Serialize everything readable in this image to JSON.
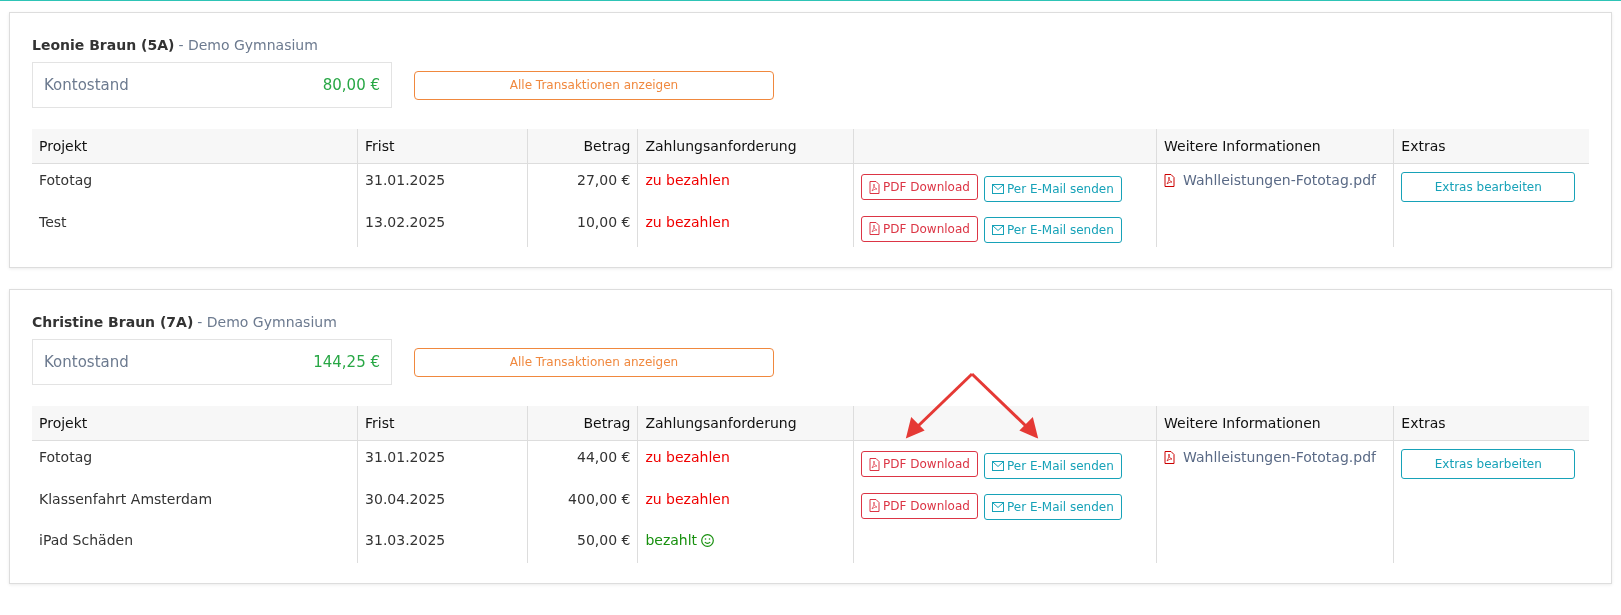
{
  "students": [
    {
      "name": "Leonie Braun (5A)",
      "school": "- Demo Gymnasium",
      "balance_label": "Kontostand",
      "balance": "80,00 €",
      "transactions_button": "Alle Transaktionen anzeigen",
      "arrow_annotation": false,
      "columns": [
        "Projekt",
        "Frist",
        "Betrag",
        "Zahlungsanforderung",
        "Weitere Informationen",
        "Extras"
      ],
      "attachment": "Wahlleistungen-Fototag.pdf",
      "extras_button": "Extras bearbeiten",
      "rows": [
        {
          "project": "Fototag",
          "due": "31.01.2025",
          "amount": "27,00 €",
          "status": "zu bezahlen",
          "kind": "unpaid",
          "buttons": [
            {
              "kind": "pdf",
              "label": "PDF Download"
            },
            {
              "kind": "email",
              "label": "Per E-Mail senden"
            }
          ]
        },
        {
          "project": "Test",
          "due": "13.02.2025",
          "amount": "10,00 €",
          "status": "zu bezahlen",
          "kind": "unpaid",
          "buttons": [
            {
              "kind": "pdf",
              "label": "PDF Download"
            },
            {
              "kind": "email",
              "label": "Per E-Mail senden"
            }
          ]
        }
      ]
    },
    {
      "name": "Christine Braun (7A)",
      "school": "- Demo Gymnasium",
      "balance_label": "Kontostand",
      "balance": "144,25 €",
      "transactions_button": "Alle Transaktionen anzeigen",
      "arrow_annotation": true,
      "columns": [
        "Projekt",
        "Frist",
        "Betrag",
        "Zahlungsanforderung",
        "Weitere Informationen",
        "Extras"
      ],
      "attachment": "Wahlleistungen-Fototag.pdf",
      "extras_button": "Extras bearbeiten",
      "rows": [
        {
          "project": "Fototag",
          "due": "31.01.2025",
          "amount": "44,00 €",
          "status": "zu bezahlen",
          "kind": "unpaid",
          "buttons": [
            {
              "kind": "pdf",
              "label": "PDF Download"
            },
            {
              "kind": "email",
              "label": "Per E-Mail senden"
            }
          ]
        },
        {
          "project": "Klassenfahrt Amsterdam",
          "due": "30.04.2025",
          "amount": "400,00 €",
          "status": "zu bezahlen",
          "kind": "unpaid",
          "buttons": [
            {
              "kind": "pdf",
              "label": "PDF Download"
            },
            {
              "kind": "email",
              "label": "Per E-Mail senden"
            }
          ]
        },
        {
          "project": "iPad Schäden",
          "due": "31.03.2025",
          "amount": "50,00 €",
          "status": "bezahlt",
          "kind": "paid",
          "buttons": []
        }
      ]
    }
  ]
}
